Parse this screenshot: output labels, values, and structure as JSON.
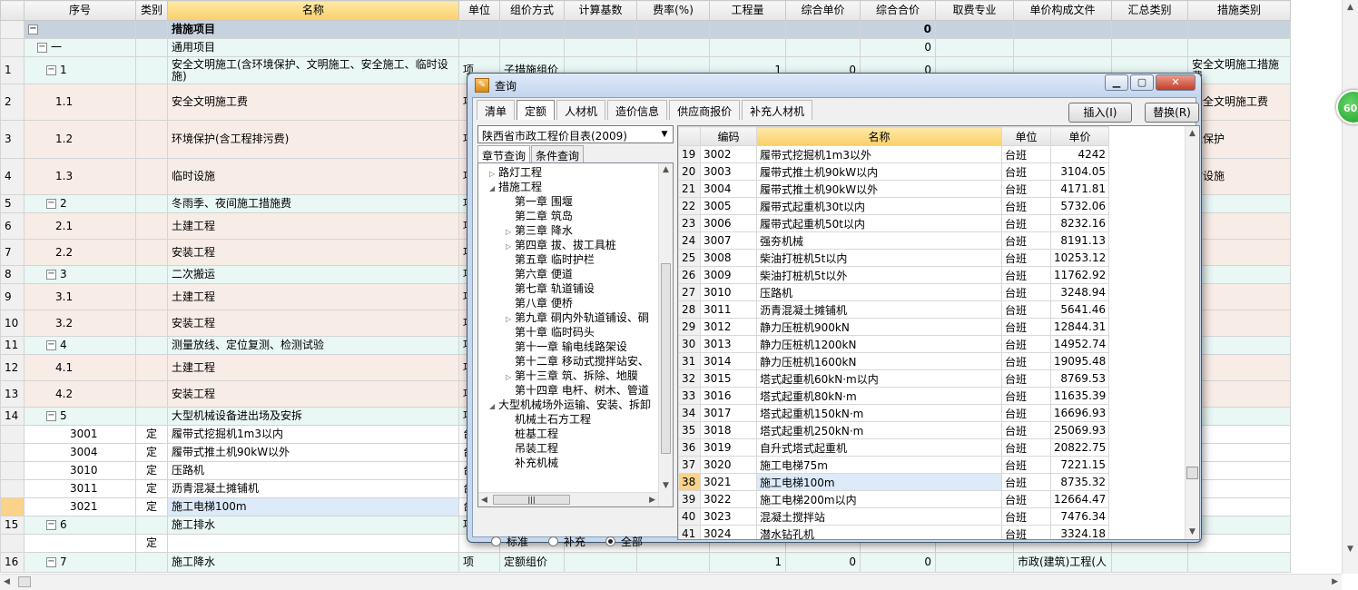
{
  "main_grid": {
    "columns": [
      "",
      "序号",
      "类别",
      "名称",
      "单位",
      "组价方式",
      "计算基数",
      "费率(%)",
      "工程量",
      "综合单价",
      "综合合价",
      "取费专业",
      "单价构成文件",
      "汇总类别",
      "措施类别"
    ],
    "rows": [
      {
        "rn": "",
        "seq": "",
        "type": "",
        "name": "措施项目",
        "unit": "",
        "method": "",
        "base": "",
        "rate": "",
        "qty": "",
        "uprice": "",
        "total": "0",
        "prof": "",
        "file": "",
        "sum": "",
        "cat": "",
        "bg": "#c7d2df",
        "bold": true,
        "exp": "−",
        "lvl": 0
      },
      {
        "rn": "",
        "seq": "一",
        "type": "",
        "name": "通用项目",
        "unit": "",
        "method": "",
        "base": "",
        "rate": "",
        "qty": "",
        "uprice": "",
        "total": "0",
        "prof": "",
        "file": "",
        "sum": "",
        "cat": "",
        "bg": "#e9f7f5",
        "exp": "−",
        "lvl": 1
      },
      {
        "rn": "1",
        "seq": "1",
        "type": "",
        "name": "安全文明施工(含环境保护、文明施工、安全施工、临时设施)",
        "unit": "项",
        "method": "子措施组价",
        "base": "",
        "rate": "",
        "qty": "1",
        "uprice": "0",
        "total": "0",
        "prof": "",
        "file": "",
        "sum": "",
        "cat": "安全文明施工措施费",
        "bg": "#e9f7f5",
        "exp": "−",
        "lvl": 2,
        "h": 30
      },
      {
        "rn": "2",
        "seq": "1.1",
        "type": "",
        "name": "安全文明施工费",
        "unit": "项",
        "method": "",
        "base": "",
        "rate": "",
        "qty": "",
        "uprice": "",
        "total": "",
        "prof": "",
        "file": "",
        "sum": "",
        "cat": "安全文明施工费",
        "bg": "#f8ece6",
        "lvl": 3,
        "h": 40
      },
      {
        "rn": "3",
        "seq": "1.2",
        "type": "",
        "name": "环境保护(含工程排污费)",
        "unit": "项",
        "method": "",
        "base": "",
        "rate": "",
        "qty": "",
        "uprice": "",
        "total": "",
        "prof": "",
        "file": "",
        "sum": "",
        "cat": "境保护",
        "bg": "#f8ece6",
        "lvl": 3,
        "h": 42
      },
      {
        "rn": "4",
        "seq": "1.3",
        "type": "",
        "name": "临时设施",
        "unit": "项",
        "method": "",
        "base": "",
        "rate": "",
        "qty": "",
        "uprice": "",
        "total": "",
        "prof": "",
        "file": "",
        "sum": "",
        "cat": "时设施",
        "bg": "#f8ece6",
        "lvl": 3,
        "h": 40
      },
      {
        "rn": "5",
        "seq": "2",
        "type": "",
        "name": "冬雨季、夜间施工措施费",
        "unit": "项",
        "method": "",
        "base": "",
        "rate": "",
        "qty": "",
        "uprice": "",
        "total": "",
        "prof": "",
        "file": "",
        "sum": "",
        "cat": "",
        "bg": "#e9f7f5",
        "exp": "−",
        "lvl": 2
      },
      {
        "rn": "6",
        "seq": "2.1",
        "type": "",
        "name": "土建工程",
        "unit": "项",
        "method": "",
        "base": "",
        "rate": "",
        "qty": "",
        "uprice": "",
        "total": "",
        "prof": "",
        "file": "",
        "sum": "",
        "cat": "",
        "bg": "#f8ece6",
        "lvl": 3,
        "h": 29
      },
      {
        "rn": "7",
        "seq": "2.2",
        "type": "",
        "name": "安装工程",
        "unit": "项",
        "method": "",
        "base": "",
        "rate": "",
        "qty": "",
        "uprice": "",
        "total": "",
        "prof": "",
        "file": "",
        "sum": "",
        "cat": "",
        "bg": "#f8ece6",
        "lvl": 3,
        "h": 29
      },
      {
        "rn": "8",
        "seq": "3",
        "type": "",
        "name": "二次搬运",
        "unit": "项",
        "method": "",
        "base": "",
        "rate": "",
        "qty": "",
        "uprice": "",
        "total": "",
        "prof": "",
        "file": "",
        "sum": "",
        "cat": "",
        "bg": "#e9f7f5",
        "exp": "−",
        "lvl": 2
      },
      {
        "rn": "9",
        "seq": "3.1",
        "type": "",
        "name": "土建工程",
        "unit": "项",
        "method": "",
        "base": "",
        "rate": "",
        "qty": "",
        "uprice": "",
        "total": "",
        "prof": "",
        "file": "",
        "sum": "",
        "cat": "",
        "bg": "#f8ece6",
        "lvl": 3,
        "h": 29
      },
      {
        "rn": "10",
        "seq": "3.2",
        "type": "",
        "name": "安装工程",
        "unit": "项",
        "method": "",
        "base": "",
        "rate": "",
        "qty": "",
        "uprice": "",
        "total": "",
        "prof": "",
        "file": "",
        "sum": "",
        "cat": "",
        "bg": "#f8ece6",
        "lvl": 3,
        "h": 29
      },
      {
        "rn": "11",
        "seq": "4",
        "type": "",
        "name": "测量放线、定位复测、检测试验",
        "unit": "项",
        "method": "",
        "base": "",
        "rate": "",
        "qty": "",
        "uprice": "",
        "total": "",
        "prof": "",
        "file": "",
        "sum": "",
        "cat": "",
        "bg": "#e9f7f5",
        "exp": "−",
        "lvl": 2
      },
      {
        "rn": "12",
        "seq": "4.1",
        "type": "",
        "name": "土建工程",
        "unit": "项",
        "method": "",
        "base": "",
        "rate": "",
        "qty": "",
        "uprice": "",
        "total": "",
        "prof": "",
        "file": "",
        "sum": "",
        "cat": "",
        "bg": "#f8ece6",
        "lvl": 3,
        "h": 29
      },
      {
        "rn": "13",
        "seq": "4.2",
        "type": "",
        "name": "安装工程",
        "unit": "项",
        "method": "",
        "base": "",
        "rate": "",
        "qty": "",
        "uprice": "",
        "total": "",
        "prof": "",
        "file": "",
        "sum": "",
        "cat": "",
        "bg": "#f8ece6",
        "lvl": 3,
        "h": 29
      },
      {
        "rn": "14",
        "seq": "5",
        "type": "",
        "name": "大型机械设备进出场及安拆",
        "unit": "项",
        "method": "",
        "base": "",
        "rate": "",
        "qty": "",
        "uprice": "",
        "total": "",
        "prof": "",
        "file": "",
        "sum": "",
        "cat": "",
        "bg": "#e9f7f5",
        "exp": "−",
        "lvl": 2
      },
      {
        "rn": "",
        "seq": "3001",
        "type": "定",
        "name": "履带式挖掘机1m3以内",
        "unit": "台",
        "method": "",
        "base": "",
        "rate": "",
        "qty": "",
        "uprice": "",
        "total": "",
        "prof": "",
        "file": "",
        "sum": "",
        "cat": "",
        "bg": "#ffffff",
        "lvl": 4,
        "h": 19
      },
      {
        "rn": "",
        "seq": "3004",
        "type": "定",
        "name": "履带式推土机90kW以外",
        "unit": "台",
        "method": "",
        "base": "",
        "rate": "",
        "qty": "",
        "uprice": "",
        "total": "",
        "prof": "",
        "file": "",
        "sum": "",
        "cat": "",
        "bg": "#ffffff",
        "lvl": 4,
        "h": 19
      },
      {
        "rn": "",
        "seq": "3010",
        "type": "定",
        "name": "压路机",
        "unit": "台",
        "method": "",
        "base": "",
        "rate": "",
        "qty": "",
        "uprice": "",
        "total": "",
        "prof": "",
        "file": "",
        "sum": "",
        "cat": "",
        "bg": "#ffffff",
        "lvl": 4,
        "h": 19
      },
      {
        "rn": "",
        "seq": "3011",
        "type": "定",
        "name": "沥青混凝土摊铺机",
        "unit": "台",
        "method": "",
        "base": "",
        "rate": "",
        "qty": "",
        "uprice": "",
        "total": "",
        "prof": "",
        "file": "",
        "sum": "",
        "cat": "",
        "bg": "#ffffff",
        "lvl": 4,
        "h": 19
      },
      {
        "rn": "",
        "seq": "3021",
        "type": "定",
        "name": "施工电梯100m",
        "unit": "台",
        "method": "",
        "base": "",
        "rate": "",
        "qty": "",
        "uprice": "",
        "total": "",
        "prof": "",
        "file": "",
        "sum": "",
        "cat": "",
        "bg": "#ffffff",
        "sel": true,
        "lvl": 4,
        "h": 19
      },
      {
        "rn": "15",
        "seq": "6",
        "type": "",
        "name": "施工排水",
        "unit": "项",
        "method": "",
        "base": "",
        "rate": "",
        "qty": "",
        "uprice": "",
        "total": "",
        "prof": "",
        "file": "",
        "sum": "",
        "cat": "",
        "bg": "#e9f7f5",
        "exp": "−",
        "lvl": 2
      },
      {
        "rn": "",
        "seq": "",
        "type": "定",
        "name": "",
        "unit": "",
        "method": "",
        "base": "",
        "rate": "",
        "qty": "",
        "uprice": "",
        "total": "",
        "prof": "",
        "file": "",
        "sum": "",
        "cat": "",
        "bg": "#ffffff",
        "lvl": 4
      },
      {
        "rn": "16",
        "seq": "7",
        "type": "",
        "name": "施工降水",
        "unit": "项",
        "method": "定额组价",
        "base": "",
        "rate": "",
        "qty": "1",
        "uprice": "0",
        "total": "0",
        "prof": "",
        "file": "市政(建筑)工程(人",
        "sum": "",
        "cat": "",
        "bg": "#e9f7f5",
        "exp": "−",
        "lvl": 2,
        "h": 22
      }
    ]
  },
  "side_badge": "60",
  "dialog": {
    "title": "查询",
    "title_icon": "query-icon",
    "tabs": [
      "清单",
      "定额",
      "人材机",
      "造价信息",
      "供应商报价",
      "补充人材机"
    ],
    "active_tab": 1,
    "insert_label": "插入(I)",
    "replace_label": "替换(R)",
    "library": "陕西省市政工程价目表(2009)",
    "subtabs": [
      "章节查询",
      "条件查询"
    ],
    "tree": [
      {
        "t": "路灯工程",
        "lvl": 0,
        "tri": "▷"
      },
      {
        "t": "措施工程",
        "lvl": 0,
        "tri": "◢"
      },
      {
        "t": "第一章  围堰",
        "lvl": 1,
        "tri": ""
      },
      {
        "t": "第二章  筑岛",
        "lvl": 1,
        "tri": ""
      },
      {
        "t": "第三章  降水",
        "lvl": 1,
        "tri": "▷"
      },
      {
        "t": "第四章  拔、拔工具桩",
        "lvl": 1,
        "tri": "▷"
      },
      {
        "t": "第五章  临时护栏",
        "lvl": 1,
        "tri": ""
      },
      {
        "t": "第六章  便道",
        "lvl": 1,
        "tri": ""
      },
      {
        "t": "第七章  轨道铺设",
        "lvl": 1,
        "tri": ""
      },
      {
        "t": "第八章  便桥",
        "lvl": 1,
        "tri": ""
      },
      {
        "t": "第九章  硐内外轨道铺设、硐",
        "lvl": 1,
        "tri": "▷"
      },
      {
        "t": "第十章  临时码头",
        "lvl": 1,
        "tri": ""
      },
      {
        "t": "第十一章  输电线路架设",
        "lvl": 1,
        "tri": ""
      },
      {
        "t": "第十二章  移动式搅拌站安、",
        "lvl": 1,
        "tri": ""
      },
      {
        "t": "第十三章  筑、拆除、地膜",
        "lvl": 1,
        "tri": "▷"
      },
      {
        "t": "第十四章  电杆、树木、管道",
        "lvl": 1,
        "tri": ""
      },
      {
        "t": "大型机械场外运输、安装、拆卸",
        "lvl": 0,
        "tri": "◢"
      },
      {
        "t": "机械土石方工程",
        "lvl": 1,
        "tri": ""
      },
      {
        "t": "桩基工程",
        "lvl": 1,
        "tri": ""
      },
      {
        "t": "吊装工程",
        "lvl": 1,
        "tri": ""
      },
      {
        "t": "补充机械",
        "lvl": 1,
        "tri": ""
      }
    ],
    "radios": [
      "标准",
      "补充",
      "全部"
    ],
    "radio_selected": 2,
    "grid_columns": [
      "",
      "编码",
      "名称",
      "单位",
      "单价"
    ],
    "grid_rows": [
      [
        "19",
        "3002",
        "履带式挖掘机1m3以外",
        "台班",
        "4242"
      ],
      [
        "20",
        "3003",
        "履带式推土机90kW以内",
        "台班",
        "3104.05"
      ],
      [
        "21",
        "3004",
        "履带式推土机90kW以外",
        "台班",
        "4171.81"
      ],
      [
        "22",
        "3005",
        "履带式起重机30t以内",
        "台班",
        "5732.06"
      ],
      [
        "23",
        "3006",
        "履带式起重机50t以内",
        "台班",
        "8232.16"
      ],
      [
        "24",
        "3007",
        "强夯机械",
        "台班",
        "8191.13"
      ],
      [
        "25",
        "3008",
        "柴油打桩机5t以内",
        "台班",
        "10253.12"
      ],
      [
        "26",
        "3009",
        "柴油打桩机5t以外",
        "台班",
        "11762.92"
      ],
      [
        "27",
        "3010",
        "压路机",
        "台班",
        "3248.94"
      ],
      [
        "28",
        "3011",
        "沥青混凝土摊铺机",
        "台班",
        "5641.46"
      ],
      [
        "29",
        "3012",
        "静力压桩机900kN",
        "台班",
        "12844.31"
      ],
      [
        "30",
        "3013",
        "静力压桩机1200kN",
        "台班",
        "14952.74"
      ],
      [
        "31",
        "3014",
        "静力压桩机1600kN",
        "台班",
        "19095.48"
      ],
      [
        "32",
        "3015",
        "塔式起重机60kN·m以内",
        "台班",
        "8769.53"
      ],
      [
        "33",
        "3016",
        "塔式起重机80kN·m",
        "台班",
        "11635.39"
      ],
      [
        "34",
        "3017",
        "塔式起重机150kN·m",
        "台班",
        "16696.93"
      ],
      [
        "35",
        "3018",
        "塔式起重机250kN·m",
        "台班",
        "25069.93"
      ],
      [
        "36",
        "3019",
        "自升式塔式起重机",
        "台班",
        "20822.75"
      ],
      [
        "37",
        "3020",
        "施工电梯75m",
        "台班",
        "7221.15"
      ],
      [
        "38",
        "3021",
        "施工电梯100m",
        "台班",
        "8735.32"
      ],
      [
        "39",
        "3022",
        "施工电梯200m以内",
        "台班",
        "12664.47"
      ],
      [
        "40",
        "3023",
        "混凝土搅拌站",
        "台班",
        "7476.34"
      ],
      [
        "41",
        "3024",
        "潜水钻孔机",
        "台班",
        "3324.18"
      ]
    ],
    "selected_row": 19
  }
}
